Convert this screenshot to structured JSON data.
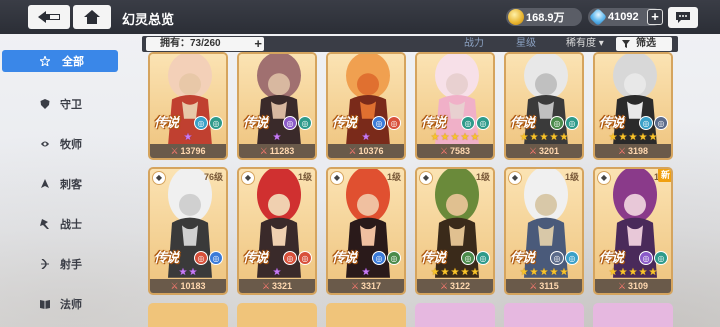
{
  "header": {
    "title": "幻灵总览",
    "gold": "168.9万",
    "gems": "41092",
    "plus": "+"
  },
  "sidebar": {
    "items": [
      {
        "label": "全部",
        "icon": "star-icon",
        "active": true
      },
      {
        "label": "守卫",
        "icon": "shield-icon"
      },
      {
        "label": "牧师",
        "icon": "heal-icon"
      },
      {
        "label": "刺客",
        "icon": "dagger-icon"
      },
      {
        "label": "战士",
        "icon": "axe-icon"
      },
      {
        "label": "射手",
        "icon": "bow-icon"
      },
      {
        "label": "法师",
        "icon": "book-icon"
      }
    ]
  },
  "filter": {
    "owned": "拥有：73/260",
    "owned_plus": "+",
    "power": "战力",
    "star": "星级",
    "rarity": "稀有度 ▾",
    "filter_label": "筛选"
  },
  "cards": [
    {
      "power": "13796",
      "badge": "传说",
      "stars": 1,
      "star_color": "purple",
      "level": "",
      "elems": [
        "#3aa0c8",
        "#2e9a8a"
      ]
    },
    {
      "power": "11283",
      "badge": "传说",
      "stars": 1,
      "star_color": "purple",
      "level": "",
      "elems": [
        "#8a5ac8",
        "#2e9a8a"
      ]
    },
    {
      "power": "10376",
      "badge": "传说",
      "stars": 1,
      "star_color": "purple",
      "level": "",
      "elems": [
        "#3a7ad8",
        "#d8503a"
      ]
    },
    {
      "power": "7583",
      "badge": "传说",
      "stars": 5,
      "star_color": "yellow",
      "level": "",
      "elems": [
        "#2e9a8a",
        "#2e9a8a"
      ]
    },
    {
      "power": "3201",
      "badge": "传说",
      "stars": 5,
      "star_color": "yellow",
      "level": "",
      "elems": [
        "#4a8a4a",
        "#2e9a8a"
      ]
    },
    {
      "power": "3198",
      "badge": "传说",
      "stars": 5,
      "star_color": "yellow",
      "level": "",
      "elems": [
        "#3aa0c8",
        "#5a6a8a"
      ]
    },
    {
      "power": "10183",
      "badge": "传说",
      "stars": 2,
      "star_color": "purple",
      "level": "76级",
      "elems": [
        "#d8503a",
        "#3a7ad8"
      ]
    },
    {
      "power": "3321",
      "badge": "传说",
      "stars": 1,
      "star_color": "purple",
      "level": "1级",
      "elems": [
        "#d8503a",
        "#d8503a"
      ]
    },
    {
      "power": "3317",
      "badge": "传说",
      "stars": 1,
      "star_color": "purple",
      "level": "1级",
      "elems": [
        "#3a7ad8",
        "#4a8a4a"
      ]
    },
    {
      "power": "3122",
      "badge": "传说",
      "stars": 5,
      "star_color": "yellow",
      "level": "1级",
      "elems": [
        "#4a8a4a",
        "#2e9a8a"
      ]
    },
    {
      "power": "3115",
      "badge": "传说",
      "stars": 5,
      "star_color": "yellow",
      "level": "1级",
      "elems": [
        "#5a6a8a",
        "#3aa0c8"
      ]
    },
    {
      "power": "3109",
      "badge": "传说",
      "stars": 5,
      "star_color": "yellow",
      "level": "1级",
      "new": "新",
      "elems": [
        "#8a5ac8",
        "#2e9a8a"
      ]
    }
  ]
}
